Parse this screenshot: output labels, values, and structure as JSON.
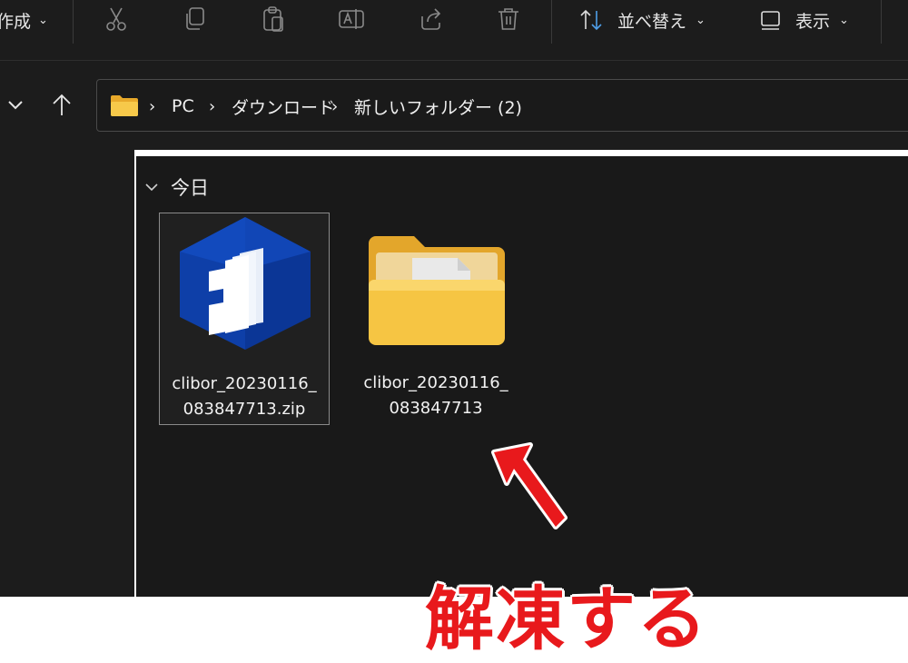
{
  "toolbar": {
    "new_label": "作成",
    "sort_label": "並べ替え",
    "view_label": "表示",
    "icons": [
      "cut-icon",
      "copy-icon",
      "paste-icon",
      "rename-icon",
      "share-icon",
      "delete-icon",
      "sort-icon",
      "view-icon"
    ]
  },
  "address": {
    "crumbs": [
      "PC",
      "ダウンロード",
      "新しいフォルダー (2)"
    ]
  },
  "group": {
    "label": "今日"
  },
  "files": [
    {
      "name_line1": "clibor_20230116_",
      "name_line2": "083847713.zip",
      "type": "zip",
      "selected": true
    },
    {
      "name_line1": "clibor_20230116_",
      "name_line2": "083847713",
      "type": "folder",
      "selected": false
    }
  ],
  "annotation": {
    "text": "解凍する",
    "color": "#e8191c"
  },
  "colors": {
    "background": "#191919",
    "chrome": "#1c1c1c",
    "accent_blue": "#0e3fa8",
    "folder_yellow": "#f6c543"
  }
}
